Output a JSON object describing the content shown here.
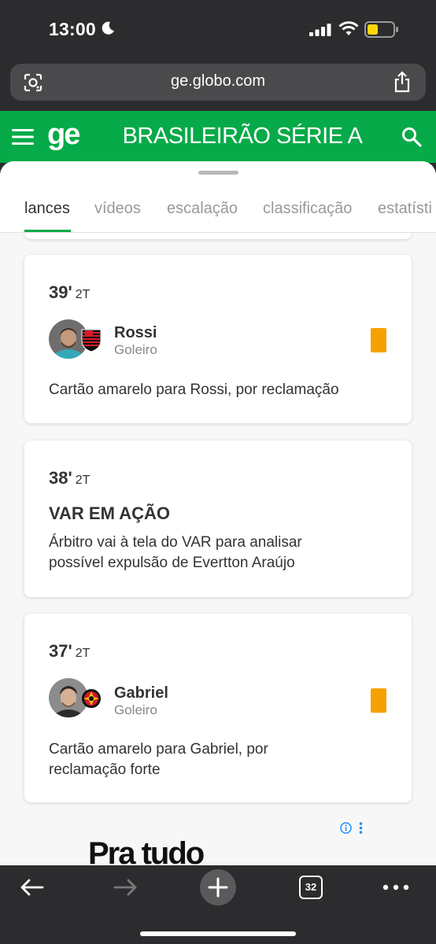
{
  "status_bar": {
    "time": "13:00",
    "icons": [
      "moon-icon",
      "signal-icon",
      "wifi-icon",
      "battery-icon"
    ]
  },
  "browser": {
    "url": "ge.globo.com",
    "tab_count": "32",
    "icons": [
      "lens-icon",
      "share-icon",
      "back-icon",
      "forward-icon",
      "new-tab-icon",
      "tabs-icon",
      "more-icon"
    ]
  },
  "header": {
    "logo": "ge",
    "title": "BRASILEIRÃO SÉRIE A",
    "icons": [
      "menu-icon",
      "search-icon"
    ],
    "color": "#06aa48"
  },
  "tabs": [
    {
      "label": "lances",
      "active": true
    },
    {
      "label": "vídeos",
      "active": false
    },
    {
      "label": "escalação",
      "active": false
    },
    {
      "label": "classificação",
      "active": false
    },
    {
      "label": "estatísti",
      "active": false
    }
  ],
  "events": [
    {
      "minute": "39'",
      "period": "2T",
      "player": {
        "name": "Rossi",
        "role": "Goleiro",
        "team_crest": "flamengo-crest-icon"
      },
      "card": "yellow",
      "description": "Cartão amarelo para Rossi, por reclamação"
    },
    {
      "minute": "38'",
      "period": "2T",
      "title": "VAR EM AÇÃO",
      "description_lines": [
        "Árbitro vai à tela do VAR para analisar",
        "possível expulsão de Evertton Araújo"
      ]
    },
    {
      "minute": "37'",
      "period": "2T",
      "player": {
        "name": "Gabriel",
        "role": "Goleiro",
        "team_crest": "sport-recife-crest-icon"
      },
      "card": "yellow",
      "description_lines": [
        "Cartão amarelo para Gabriel, por",
        "reclamação forte"
      ]
    }
  ],
  "ad": {
    "text": "Pra tudo",
    "icons": [
      "ad-info-icon",
      "ad-menu-icon"
    ]
  },
  "colors": {
    "yellow_card": "#f7a100",
    "browser_chrome": "#2c2c2e"
  }
}
